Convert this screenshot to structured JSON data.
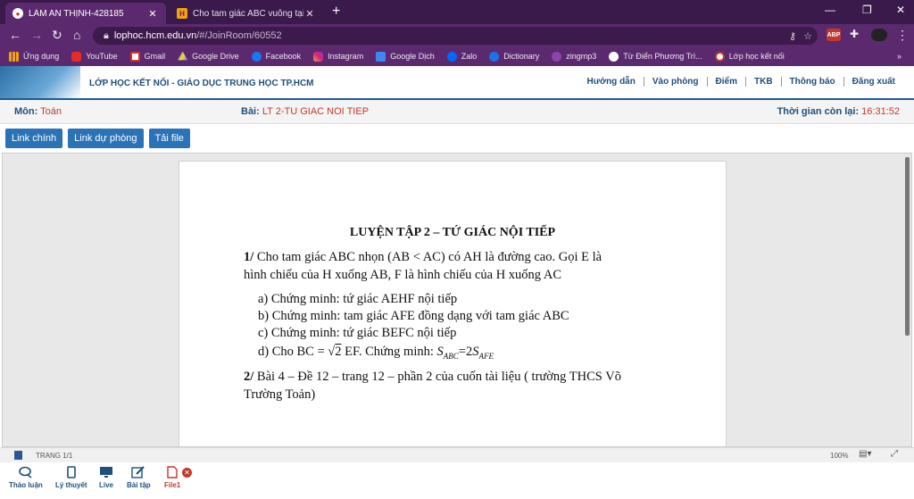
{
  "browser": {
    "tabs": [
      {
        "title": "LÂM AN THỊNH-428185",
        "active": true
      },
      {
        "title": "Cho tam giác ABC vuông tại A đư",
        "active": false
      }
    ],
    "url_host": "lophoc.hcm.edu.vn",
    "url_path": "/#/JoinRoom/60552",
    "extensions": [
      "ABP"
    ],
    "bookmarks": [
      {
        "label": "Ứng dụng",
        "icon": "apps-icon"
      },
      {
        "label": "YouTube",
        "icon": "youtube-icon"
      },
      {
        "label": "Gmail",
        "icon": "gmail-icon"
      },
      {
        "label": "Google Drive",
        "icon": "drive-icon"
      },
      {
        "label": "Facebook",
        "icon": "facebook-icon"
      },
      {
        "label": "Instagram",
        "icon": "instagram-icon"
      },
      {
        "label": "Google Dịch",
        "icon": "translate-icon"
      },
      {
        "label": "Zalo",
        "icon": "zalo-icon"
      },
      {
        "label": "Dictionary",
        "icon": "dictionary-icon"
      },
      {
        "label": "zingmp3",
        "icon": "zingmp3-icon"
      },
      {
        "label": "Từ Điển Phương Trì...",
        "icon": "dictionary-icon"
      },
      {
        "label": "Lớp học kết nối",
        "icon": "school-icon"
      }
    ],
    "more": "»"
  },
  "site": {
    "title": "LỚP HỌC KẾT NỐI -  GIÁO DỤC TRUNG HỌC TP.HCM",
    "nav": [
      "Hướng dẫn",
      "Vào phòng",
      "Điểm",
      "TKB",
      "Thông báo",
      "Đăng xuất"
    ]
  },
  "info": {
    "subject_label": "Môn:",
    "subject": "Toán",
    "lesson_label": "Bài:",
    "lesson": "LT 2-TU GIAC NOI TIEP",
    "time_label": "Thời gian còn lại:",
    "time": "16:31:52"
  },
  "buttons": [
    "Link chính",
    "Link dự phòng",
    "Tải file"
  ],
  "document": {
    "title": "LUYỆN TẬP 2 – TỨ GIÁC NỘI TIẾP",
    "q1_num": "1/",
    "q1_line1": " Cho tam giác ABC nhọn (AB < AC) có AH là đường cao. Gọi E là",
    "q1_line2": "hình chiếu của H xuống AB, F là hình chiếu của H xuống AC",
    "items": [
      "a)  Chứng minh: tứ giác AEHF nội tiếp",
      "b)  Chứng minh: tam giác AFE đồng dạng với tam giác ABC",
      "c)  Chứng minh: tứ giác BEFC nội tiếp"
    ],
    "item_d_prefix": "d)  Cho BC = ",
    "item_d_sqrt": "2",
    "item_d_mid": " EF. Chứng minh: ",
    "item_d_s1": "ABC",
    "item_d_eq": "=2",
    "item_d_s2": "AFE",
    "q2_num": "2/",
    "q2_line1": " Bài 4 – Đề 12 – trang 12 – phần 2 của cuốn tài liệu ( trường THCS Võ",
    "q2_line2": "Trường Toản)"
  },
  "status": {
    "page": "TRANG 1/1",
    "zoom": "100%"
  },
  "bottom_nav": [
    {
      "label": "Thảo luận",
      "icon": "chat-icon"
    },
    {
      "label": "Lý thuyết",
      "icon": "tablet-icon"
    },
    {
      "label": "Live",
      "icon": "monitor-icon"
    },
    {
      "label": "Bài tập",
      "icon": "edit-icon"
    },
    {
      "label": "File1",
      "icon": "pdf-file-icon"
    }
  ],
  "colors": {
    "accent": "#2a73b8",
    "browser": "#5b2a6e",
    "highlight": "#c0392b"
  }
}
